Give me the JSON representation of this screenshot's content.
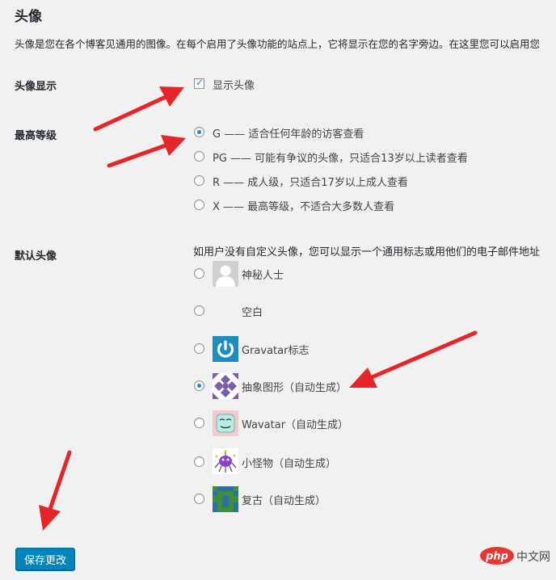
{
  "section_title": "头像",
  "description": "头像是您在各个博客见通用的图像。在每个启用了头像功能的站点上，它将显示在您的名字旁边。在这里您可以启用您",
  "show_avatars": {
    "label": "头像显示",
    "checkbox_label": "显示头像",
    "checked": true
  },
  "max_rating": {
    "label": "最高等级",
    "options": [
      {
        "label": "G —— 适合任何年龄的访客查看",
        "checked": true
      },
      {
        "label": "PG —— 可能有争议的头像，只适合13岁以上读者查看",
        "checked": false
      },
      {
        "label": "R —— 成人级，只适合17岁以上成人查看",
        "checked": false
      },
      {
        "label": "X —— 最高等级，不适合大多数人查看",
        "checked": false
      }
    ]
  },
  "default_avatar": {
    "label": "默认头像",
    "description": "如用户没有自定义头像，您可以显示一个通用标志或用他们的电子邮件地址",
    "options": [
      {
        "label": "神秘人士",
        "checked": false,
        "icon": "mystery-person-avatar"
      },
      {
        "label": "空白",
        "checked": false,
        "icon": "blank-avatar"
      },
      {
        "label": "Gravatar标志",
        "checked": false,
        "icon": "gravatar-logo-avatar"
      },
      {
        "label": "抽象图形（自动生成）",
        "checked": true,
        "icon": "identicon-avatar"
      },
      {
        "label": "Wavatar（自动生成）",
        "checked": false,
        "icon": "wavatar-avatar"
      },
      {
        "label": "小怪物（自动生成）",
        "checked": false,
        "icon": "monsterid-avatar"
      },
      {
        "label": "复古（自动生成）",
        "checked": false,
        "icon": "retro-avatar"
      }
    ]
  },
  "save_button_label": "保存更改",
  "watermark": {
    "logo": "php",
    "text": "中文网"
  },
  "colors": {
    "accent": "#0085ba",
    "arrow": "#e52528",
    "background": "#f1f1f1"
  }
}
